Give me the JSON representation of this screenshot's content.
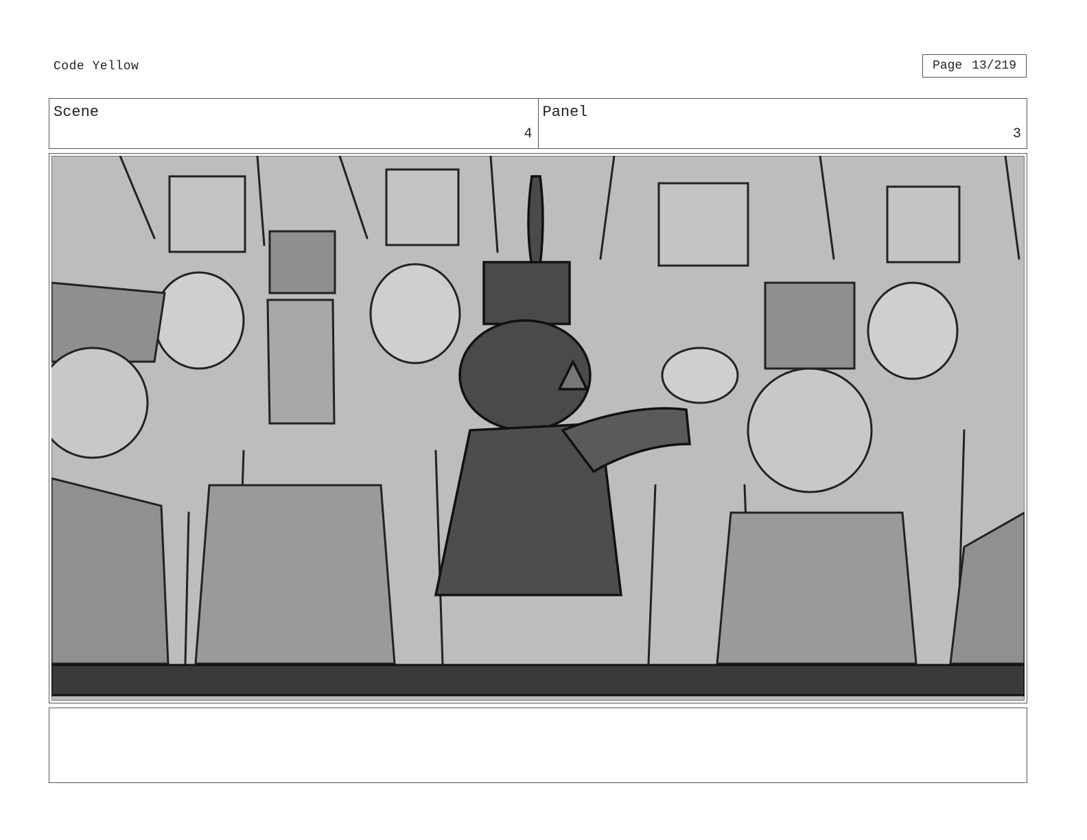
{
  "header": {
    "title": "Code Yellow",
    "page_label": "Page",
    "page_number": "13/219"
  },
  "info": {
    "scene_label": "Scene",
    "scene_value": "4",
    "panel_label": "Panel",
    "panel_value": "3"
  },
  "artwork": {
    "description_icon": "storyboard-sketch-marching-band",
    "bg_color": "#bdbdbd",
    "shadow_color": "#8a8a8a",
    "dark_color": "#4a4a4a",
    "stage_color": "#3a3a3a"
  },
  "notes": {
    "text": ""
  }
}
